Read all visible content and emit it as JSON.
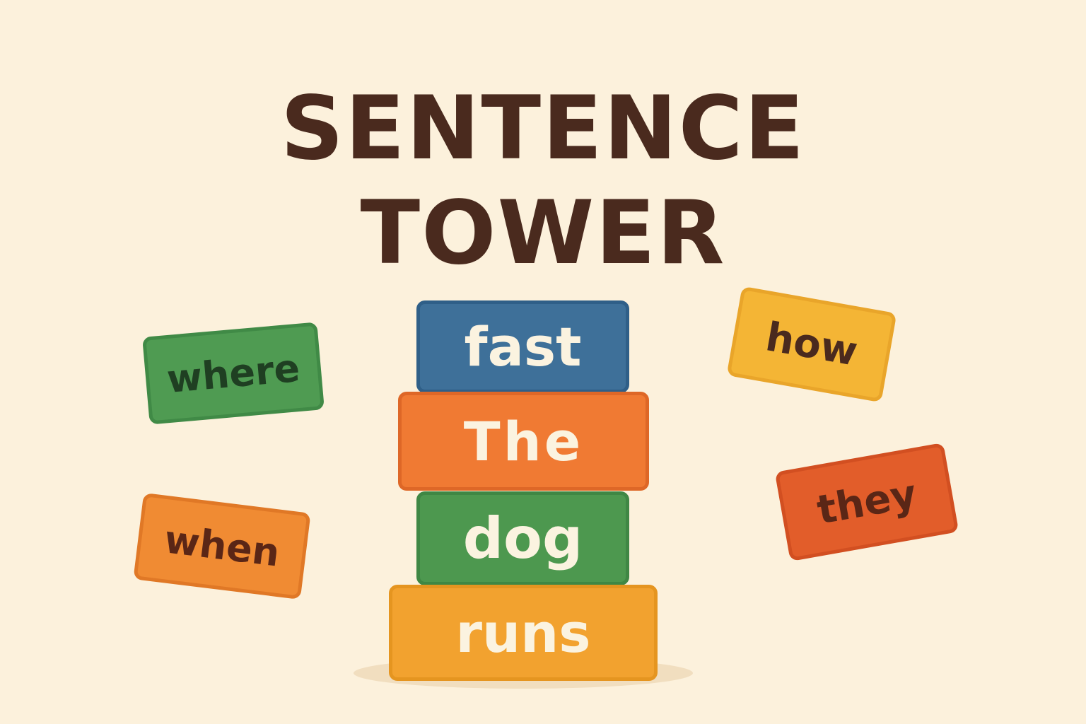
{
  "title": {
    "line1": "SENTENCE",
    "line2": "TOWER"
  },
  "tower": {
    "blocks": [
      {
        "word": "fast",
        "color": "#3e7099"
      },
      {
        "word": "The",
        "color": "#f07a33"
      },
      {
        "word": "dog",
        "color": "#4d984f"
      },
      {
        "word": "runs",
        "color": "#f2a22f"
      }
    ]
  },
  "word_bank": {
    "cards": [
      {
        "word": "where",
        "color": "#4f9b52"
      },
      {
        "word": "when",
        "color": "#f08b33"
      },
      {
        "word": "how",
        "color": "#f4b535"
      },
      {
        "word": "they",
        "color": "#e25d2a"
      }
    ]
  },
  "colors": {
    "background": "#fcf1dc",
    "title": "#4a2a1e"
  }
}
